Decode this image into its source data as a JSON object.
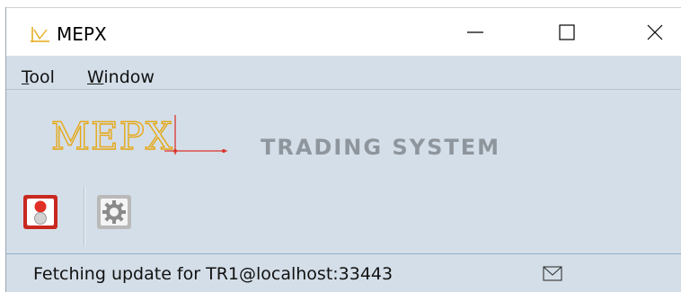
{
  "window": {
    "title": "MEPX",
    "controls": {
      "minimize": "—",
      "maximize": "☐",
      "close": "✕"
    }
  },
  "menu": {
    "items": [
      {
        "mnemonic": "T",
        "rest": "ool"
      },
      {
        "mnemonic": "W",
        "rest": "indow"
      }
    ]
  },
  "branding": {
    "logo_text": "MEPX",
    "tagline": "TRADING SYSTEM",
    "logo_color": "#e6a817",
    "logo_accent": "#d9342b"
  },
  "toolbar": {
    "buttons": [
      {
        "icon": "traffic-light-icon"
      },
      {
        "icon": "gear-icon"
      }
    ]
  },
  "status": {
    "text": "Fetching update for TR1@localhost:33443",
    "icon": "mail-icon"
  },
  "colors": {
    "chrome_bg": "#d4dee8",
    "status_border": "#8fb0cc",
    "tagline": "#8e959c"
  }
}
